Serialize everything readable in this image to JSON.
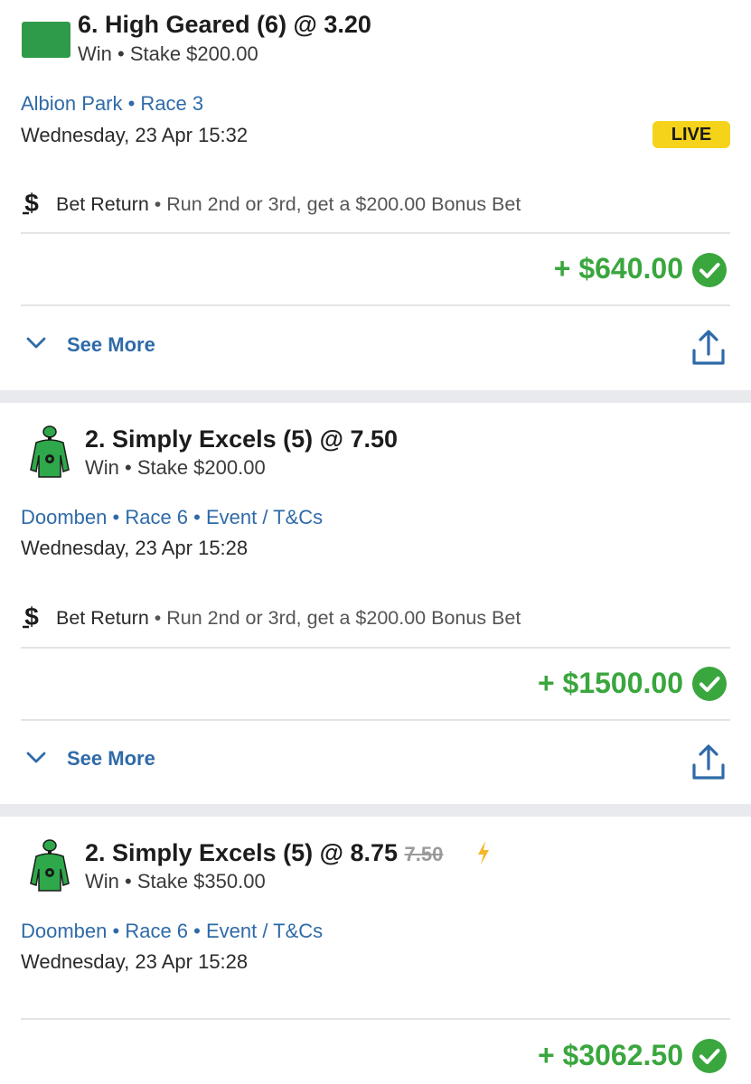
{
  "colors": {
    "accent_blue": "#2f6aa8",
    "win_green": "#3aa63e",
    "live_yellow": "#f5d31a",
    "silk_green": "#2ea84a",
    "boost_orange": "#f5b62b"
  },
  "bets": [
    {
      "title": "6. High Geared (6) @ 3.20",
      "subtitle": "Win • Stake $200.00",
      "venue_line": "Albion Park • Race 3",
      "datetime": "Wednesday, 23 Apr 15:32",
      "badge": "LIVE",
      "promo_label": "Bet Return",
      "promo_text": " • Run 2nd or 3rd, get a $200.00 Bonus Bet",
      "amount": "+ $640.00",
      "see_more": "See More",
      "icons": [
        "green-flag-icon",
        "dollar-return-icon",
        "check-circle-icon",
        "chevron-down-icon",
        "share-icon"
      ]
    },
    {
      "title": "2. Simply Excels (5) @ 7.50",
      "subtitle": "Win • Stake $200.00",
      "venue_line": "Doomben • Race 6 • Event / T&Cs",
      "datetime": "Wednesday, 23 Apr 15:28",
      "promo_label": "Bet Return",
      "promo_text": " • Run 2nd or 3rd, get a $200.00 Bonus Bet",
      "amount": "+ $1500.00",
      "see_more": "See More",
      "icons": [
        "jockey-silks-icon",
        "dollar-return-icon",
        "check-circle-icon",
        "chevron-down-icon",
        "share-icon"
      ]
    },
    {
      "title": "2. Simply Excels (5) @ 8.75",
      "old_odds": "7.50",
      "subtitle": "Win • Stake $350.00",
      "venue_line": "Doomben • Race 6 • Event / T&Cs",
      "datetime": "Wednesday, 23 Apr 15:28",
      "amount": "+ $3062.50",
      "icons": [
        "jockey-silks-icon",
        "lightning-boost-icon",
        "check-circle-icon"
      ]
    }
  ]
}
